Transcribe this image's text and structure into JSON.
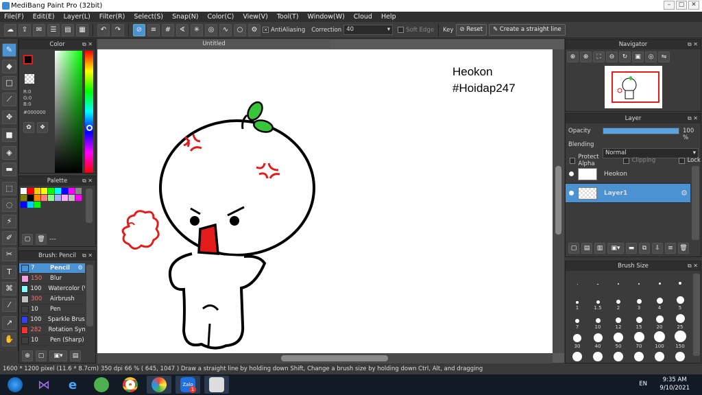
{
  "app": {
    "title": "MediBang Paint Pro (32bit)"
  },
  "window_controls": [
    "–",
    "▢",
    "✕"
  ],
  "menu": [
    "File(F)",
    "Edit(E)",
    "Layer(L)",
    "Filter(R)",
    "Select(S)",
    "Snap(N)",
    "Color(C)",
    "View(V)",
    "Tool(T)",
    "Window(W)",
    "Cloud",
    "Help"
  ],
  "toolbar": {
    "antialiasing_label": "AntiAliasing",
    "correction_label": "Correction",
    "correction_value": "40",
    "soft_edge_label": "Soft Edge",
    "key_label": "Key",
    "reset_label": "Reset",
    "straight_line_label": "Create a straight line"
  },
  "color_panel": {
    "title": "Color",
    "r": "R:0",
    "g": "G:0",
    "b": "B:0",
    "hex": "#000000",
    "primary_color": "#000000",
    "secondary_color": "#ffffff",
    "accent_color": "#e21b1b"
  },
  "palette_panel": {
    "title": "Palette",
    "more_label": "---",
    "colors": [
      "#ffffff",
      "#ff0000",
      "#ffcc00",
      "#ffff00",
      "#00ff00",
      "#00ffff",
      "#0000ff",
      "#ff00ff",
      "#888888",
      "#808000",
      "#000000",
      "#ff8800",
      "#ff8080",
      "#88ff88",
      "#aaaaff",
      "#ffaaff",
      "#c0c0c0",
      "#ff00ff",
      "#0000ff",
      "#00ccff",
      "#00ff00"
    ]
  },
  "brush_panel": {
    "title": "Brush: Pencil",
    "brushes": [
      {
        "size": "7",
        "name": "Pencil",
        "color": "#4b92d3",
        "selected": true
      },
      {
        "size": "150",
        "name": "Blur",
        "color": "#f0a0e0",
        "selected": false
      },
      {
        "size": "100",
        "name": "Watercolor (V",
        "color": "#80ffff",
        "selected": false
      },
      {
        "size": "300",
        "name": "Airbrush",
        "color": "#c0c0c0",
        "selected": false
      },
      {
        "size": "10",
        "name": "Pen",
        "color": "#404040",
        "selected": false
      },
      {
        "size": "100",
        "name": "Sparkle Brush",
        "color": "#3040ff",
        "selected": false
      },
      {
        "size": "282",
        "name": "Rotation Sym",
        "color": "#ff3030",
        "selected": false
      },
      {
        "size": "10",
        "name": "Pen (Sharp)",
        "color": "#404040",
        "selected": false
      }
    ]
  },
  "document": {
    "tab_title": "Untitled",
    "text_line1": "Heokon",
    "text_line2": "#Hoidap247"
  },
  "navigator_panel": {
    "title": "Navigator"
  },
  "layer_panel": {
    "title": "Layer",
    "opacity_label": "Opacity",
    "opacity_value": "100 %",
    "opacity_fraction": 1.0,
    "blending_label": "Blending",
    "blending_value": "Normal",
    "protect_alpha_label": "Protect Alpha",
    "clipping_label": "Clipping",
    "lock_label": "Lock",
    "layers": [
      {
        "name": "Heokon",
        "selected": false
      },
      {
        "name": "Layer1",
        "selected": true
      }
    ]
  },
  "brush_size_panel": {
    "title": "Brush Size",
    "sizes": [
      "",
      "",
      "",
      "",
      "",
      "",
      "1",
      "1.5",
      "2",
      "3",
      "4",
      "5",
      "7",
      "10",
      "12",
      "15",
      "20",
      "25",
      "30",
      "40",
      "50",
      "70",
      "100",
      "150",
      "",
      "",
      "",
      "",
      "",
      ""
    ]
  },
  "status_bar": {
    "text": "1600 * 1200 pixel  (11.6 * 8.7cm)  350 dpi  66 %   ( 645, 1047 )   Draw a straight line by holding down Shift, Change a brush size by holding down Ctrl, Alt, and dragging"
  },
  "taskbar": {
    "lang": "EN",
    "time": "9:35 AM",
    "date": "9/10/2021",
    "zalo_label": "Zalo",
    "zalo_badge": "1"
  }
}
